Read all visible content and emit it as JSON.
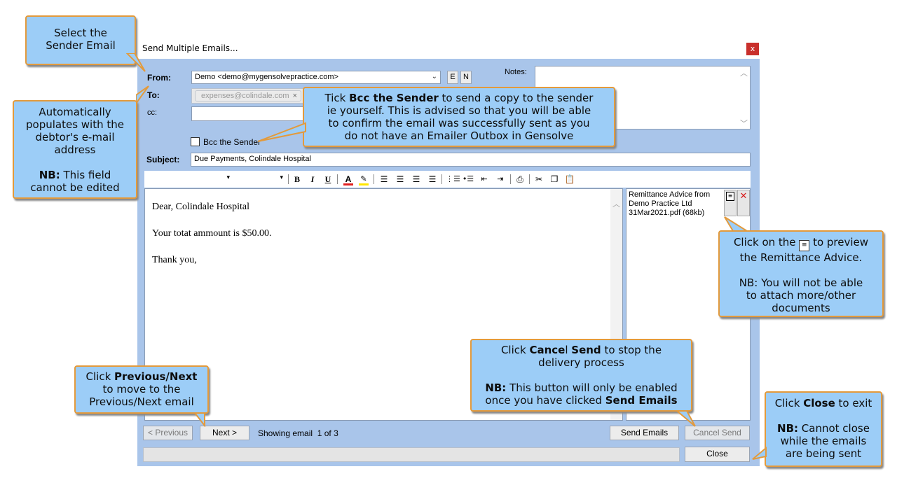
{
  "window": {
    "title": "Send Multiple Emails...",
    "close_glyph": "x"
  },
  "form": {
    "from_label": "From:",
    "from_value": "Demo <demo@mygensolvepractice.com>",
    "from_btn_e": "E",
    "from_btn_n": "N",
    "to_label": "To:",
    "to_token": "expenses@colindale.com",
    "to_token_remove": "×",
    "cc_label": "cc:",
    "cc_value": "",
    "notes_label": "Notes:",
    "notes_value": "",
    "bcc_label": "Bcc the Sender",
    "bcc_checked": false,
    "subject_label": "Subject:",
    "subject_value": "Due Payments,  Colindale Hospital"
  },
  "body": {
    "lines": [
      "Dear, Colindale Hospital",
      "Your totat ammount is $50.00.",
      "Thank you,"
    ]
  },
  "attachment": {
    "name_lines": [
      "Remittance Advice from",
      "Demo Practice Ltd",
      "31Mar2021.pdf (68kb)"
    ],
    "remove_glyph": "✕"
  },
  "footer": {
    "previous": "< Previous",
    "next": "Next >",
    "status_prefix": "Showing email",
    "status_value": "1 of 3",
    "send": "Send Emails",
    "cancel": "Cancel Send",
    "close": "Close"
  },
  "callouts": {
    "sender": {
      "line1": "Select the",
      "line2": "Sender Email"
    },
    "debtor": {
      "line1": "Automatically",
      "line2": "populates with the",
      "line3": "debtor's e-mail",
      "line4": "address",
      "nb": "NB:",
      "nb_rest": " This field",
      "line6": "cannot be edited"
    },
    "bcc": {
      "pre": "Tick ",
      "bold": "Bcc the Sender",
      "post": " to send a copy to the sender",
      "line2": "ie yourself. This is advised so that you will be able",
      "line3": "to confirm the email was successfully sent as you",
      "line4": "do not have an Emailer Outbox in Gensolve"
    },
    "preview": {
      "pre": "Click on the ",
      "post": " to preview",
      "line2": "the Remittance Advice.",
      "nb": "NB",
      "nb_rest": ": You will not be able",
      "line4": "to attach more/other",
      "line5": "documents"
    },
    "cancel": {
      "pre": "Click ",
      "bold1": "Cance",
      "mid": "l ",
      "bold2": "Send",
      "post": " to stop the",
      "line2": "delivery process",
      "nb": "NB:",
      "nb_rest": " This button will only be enabled",
      "line4_pre": "once you have clicked ",
      "line4_bold": "Send Emails"
    },
    "prevnext": {
      "pre": "Click ",
      "bold": "Previous/Next",
      "line2": "to move to the",
      "line3": "Previous/Next email"
    },
    "close": {
      "pre": "Click ",
      "bold": "Close",
      "post": " to exit",
      "nb": "NB:",
      "nb_rest": " Cannot close",
      "line3": "while the emails",
      "line4": "are being sent"
    }
  },
  "colors": {
    "frame": "#a9c5ea",
    "callout_fill": "#9ccdf7",
    "callout_border": "#e39a3c",
    "close_red": "#c9302c",
    "font_color_bar": "#e02020",
    "highlight_bar": "#ffe600"
  }
}
